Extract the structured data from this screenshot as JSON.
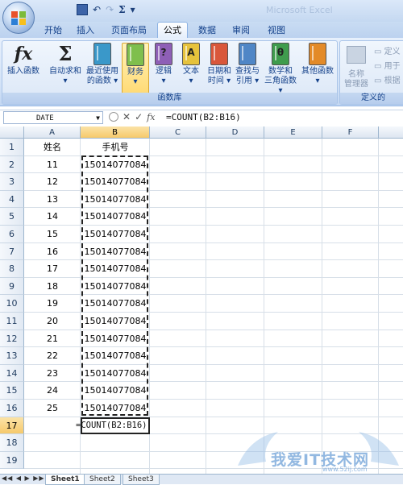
{
  "qat": {
    "undo": "↶",
    "redo": "↷",
    "sum": "Σ",
    "dropdown": "▾"
  },
  "window": {
    "title_text": "Microsoft Excel"
  },
  "tabs": [
    "开始",
    "插入",
    "页面布局",
    "公式",
    "数据",
    "审阅",
    "视图"
  ],
  "active_tab": "公式",
  "ribbon": {
    "insert_function": {
      "symbol": "fx",
      "label": "插入函数"
    },
    "autosum": {
      "symbol": "Σ",
      "line1": "自动求和",
      "line2": "▾"
    },
    "recent": {
      "line1": "最近使用",
      "line2": "的函数 ▾"
    },
    "financial": {
      "line1": "财务",
      "line2": "▾"
    },
    "logical": {
      "glyph": "?",
      "line1": "逻辑",
      "line2": "▾"
    },
    "text": {
      "glyph": "A",
      "line1": "文本",
      "line2": "▾"
    },
    "datetime": {
      "line1": "日期和",
      "line2": "时间 ▾"
    },
    "lookup": {
      "line1": "查找与",
      "line2": "引用 ▾"
    },
    "math": {
      "glyph": "θ",
      "line1": "数学和",
      "line2": "三角函数 ▾"
    },
    "more": {
      "line1": "其他函数",
      "line2": "▾"
    },
    "group_label": "函数库",
    "names": {
      "line1": "名称",
      "line2": "管理器",
      "define": "定义",
      "use": "用于",
      "create": "根据",
      "group_label": "定义的"
    },
    "colors": {
      "financial": "#7fbf4d",
      "logical": "#8e5fb6",
      "text": "#e6c23c",
      "datetime": "#d9573a",
      "lookup": "#4f86c6",
      "math": "#3f9c4d",
      "more": "#e38a28",
      "recent": "#3a98c9"
    }
  },
  "formula_bar": {
    "name_box": "DATE",
    "cancel": "✕",
    "enter": "✓",
    "fx": "fx",
    "formula": "=COUNT(B2:B16)"
  },
  "columns": [
    "A",
    "B",
    "C",
    "D",
    "E",
    "F"
  ],
  "rows": [
    "1",
    "2",
    "3",
    "4",
    "5",
    "6",
    "7",
    "8",
    "9",
    "10",
    "11",
    "12",
    "13",
    "14",
    "15",
    "16",
    "17",
    "18",
    "19"
  ],
  "headers": {
    "a1": "姓名",
    "b1": "手机号"
  },
  "data": [
    [
      "11",
      "15014077084"
    ],
    [
      "12",
      "15014077084"
    ],
    [
      "13",
      "15014077084"
    ],
    [
      "14",
      "15014077084"
    ],
    [
      "15",
      "15014077084"
    ],
    [
      "16",
      "15014077084"
    ],
    [
      "17",
      "15014077084"
    ],
    [
      "18",
      "15014077084"
    ],
    [
      "19",
      "15014077084"
    ],
    [
      "20",
      "15014077084"
    ],
    [
      "21",
      "15014077084"
    ],
    [
      "22",
      "15014077084"
    ],
    [
      "23",
      "15014077084"
    ],
    [
      "24",
      "15014077084"
    ],
    [
      "25",
      "15014077084"
    ]
  ],
  "b17": "=COUNT(B2:B16)",
  "sheets": [
    "Sheet1",
    "Sheet2",
    "Sheet3"
  ],
  "sheet_nav": "◀◀ ◀ ▶ ▶▶",
  "watermark": {
    "text": "我爱IT技术网",
    "url": "www.52ij.com"
  }
}
